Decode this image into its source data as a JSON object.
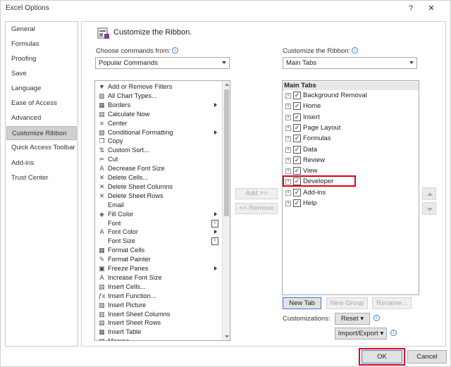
{
  "window": {
    "title": "Excel Options",
    "help_label": "?",
    "close_label": "✕"
  },
  "nav": {
    "items": [
      {
        "label": "General"
      },
      {
        "label": "Formulas"
      },
      {
        "label": "Proofing"
      },
      {
        "label": "Save"
      },
      {
        "label": "Language"
      },
      {
        "label": "Ease of Access"
      },
      {
        "label": "Advanced"
      },
      {
        "label": "Customize Ribbon"
      },
      {
        "label": "Quick Access Toolbar"
      },
      {
        "label": "Add-ins"
      },
      {
        "label": "Trust Center"
      }
    ],
    "selected": "Customize Ribbon"
  },
  "main": {
    "heading": "Customize the Ribbon.",
    "choose_label": "Choose commands from:",
    "choose_value": "Popular Commands",
    "customize_label": "Customize the Ribbon:",
    "customize_value": "Main Tabs",
    "commands": [
      {
        "label": "Add or Remove Filters",
        "icon": "filter-icon",
        "glyph": "▼",
        "extra": ""
      },
      {
        "label": "All Chart Types...",
        "icon": "chart-icon",
        "glyph": "▥",
        "extra": ""
      },
      {
        "label": "Borders",
        "icon": "borders-icon",
        "glyph": "▦",
        "extra": "submenu"
      },
      {
        "label": "Calculate Now",
        "icon": "calculate-icon",
        "glyph": "▤",
        "extra": ""
      },
      {
        "label": "Center",
        "icon": "center-icon",
        "glyph": "≡",
        "extra": ""
      },
      {
        "label": "Conditional Formatting",
        "icon": "conditional-format-icon",
        "glyph": "▧",
        "extra": "submenu"
      },
      {
        "label": "Copy",
        "icon": "copy-icon",
        "glyph": "❐",
        "extra": ""
      },
      {
        "label": "Custom Sort...",
        "icon": "sort-icon",
        "glyph": "⇅",
        "extra": ""
      },
      {
        "label": "Cut",
        "icon": "cut-icon",
        "glyph": "✂",
        "extra": ""
      },
      {
        "label": "Decrease Font Size",
        "icon": "decrease-font-icon",
        "glyph": "A",
        "extra": ""
      },
      {
        "label": "Delete Cells...",
        "icon": "delete-cells-icon",
        "glyph": "✕",
        "extra": ""
      },
      {
        "label": "Delete Sheet Columns",
        "icon": "delete-columns-icon",
        "glyph": "✕",
        "extra": ""
      },
      {
        "label": "Delete Sheet Rows",
        "icon": "delete-rows-icon",
        "glyph": "✕",
        "extra": ""
      },
      {
        "label": "Email",
        "icon": "email-icon",
        "glyph": "",
        "extra": ""
      },
      {
        "label": "Fill Color",
        "icon": "fill-color-icon",
        "glyph": "◈",
        "extra": "submenu"
      },
      {
        "label": "Font",
        "icon": "font-icon",
        "glyph": "",
        "extra": "selector"
      },
      {
        "label": "Font Color",
        "icon": "font-color-icon",
        "glyph": "A",
        "extra": "submenu"
      },
      {
        "label": "Font Size",
        "icon": "font-size-icon",
        "glyph": "",
        "extra": "selector"
      },
      {
        "label": "Format Cells",
        "icon": "format-cells-icon",
        "glyph": "▦",
        "extra": ""
      },
      {
        "label": "Format Painter",
        "icon": "format-painter-icon",
        "glyph": "✎",
        "extra": ""
      },
      {
        "label": "Freeze Panes",
        "icon": "freeze-panes-icon",
        "glyph": "▣",
        "extra": "submenu"
      },
      {
        "label": "Increase Font Size",
        "icon": "increase-font-icon",
        "glyph": "A",
        "extra": ""
      },
      {
        "label": "Insert Cells...",
        "icon": "insert-cells-icon",
        "glyph": "▤",
        "extra": ""
      },
      {
        "label": "Insert Function...",
        "icon": "insert-function-icon",
        "glyph": "ƒx",
        "extra": ""
      },
      {
        "label": "Insert Picture",
        "icon": "insert-picture-icon",
        "glyph": "▨",
        "extra": ""
      },
      {
        "label": "Insert Sheet Columns",
        "icon": "insert-columns-icon",
        "glyph": "▥",
        "extra": ""
      },
      {
        "label": "Insert Sheet Rows",
        "icon": "insert-rows-icon",
        "glyph": "▤",
        "extra": ""
      },
      {
        "label": "Insert Table",
        "icon": "insert-table-icon",
        "glyph": "▦",
        "extra": ""
      },
      {
        "label": "Macros",
        "icon": "macros-icon",
        "glyph": "▤",
        "extra": ""
      }
    ],
    "selector_glyph": "I",
    "add_label": "Add >>",
    "remove_label": "<< Remove",
    "tree_header": "Main Tabs",
    "tabs": [
      {
        "label": "Background Removal",
        "checked": "✓"
      },
      {
        "label": "Home",
        "checked": "✓"
      },
      {
        "label": "Insert",
        "checked": "✓"
      },
      {
        "label": "Page Layout",
        "checked": "✓"
      },
      {
        "label": "Formulas",
        "checked": "✓"
      },
      {
        "label": "Data",
        "checked": "✓"
      },
      {
        "label": "Review",
        "checked": "✓"
      },
      {
        "label": "View",
        "checked": "✓"
      },
      {
        "label": "Developer",
        "checked": "✓"
      },
      {
        "label": "Add-ins",
        "checked": "✓"
      },
      {
        "label": "Help",
        "checked": "✓"
      }
    ],
    "expand_glyph": "+",
    "new_tab_label": "New Tab",
    "new_group_label": "New Group",
    "rename_label": "Rename...",
    "customizations_label": "Customizations:",
    "reset_label": "Reset ▾",
    "import_export_label": "Import/Export ▾"
  },
  "footer": {
    "ok_label": "OK",
    "cancel_label": "Cancel"
  },
  "colors": {
    "highlight_red": "#e0001b",
    "selected_nav": "#d0d0d0"
  }
}
